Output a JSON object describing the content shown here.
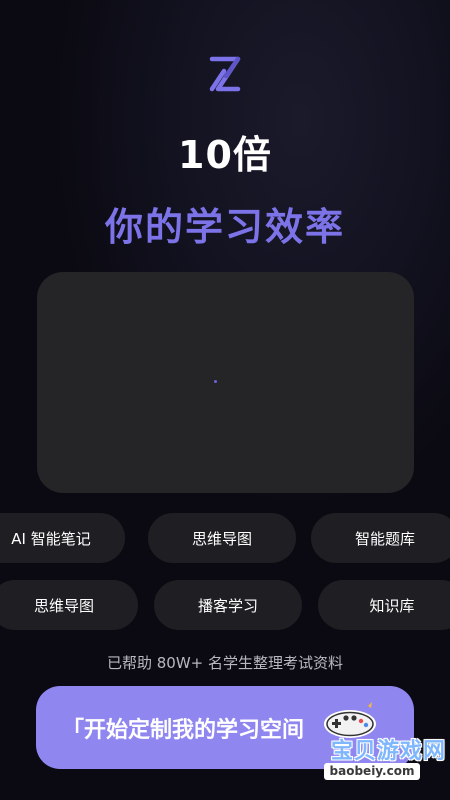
{
  "headline": {
    "line1": "10倍",
    "line2": "你的学习效率"
  },
  "features": {
    "row1": [
      "AI 智能笔记",
      "思维导图",
      "智能题库"
    ],
    "row2": [
      "思维导图",
      "播客学习",
      "知识库"
    ]
  },
  "helper_text": "已帮助 80W+ 名学生整理考试资料",
  "cta": {
    "label": "「开始定制我的学习空间"
  },
  "watermark": {
    "title": "宝贝游戏网",
    "url": "baobeiy.com"
  },
  "colors": {
    "accent": "#7d73e8",
    "button": "#8f86f0",
    "background": "#0b0a12",
    "card": "#252528",
    "chip": "#1f1f23"
  },
  "icons": {
    "logo": "hourglass-x-logo-icon",
    "watermark": "game-controller-mascot-icon"
  }
}
